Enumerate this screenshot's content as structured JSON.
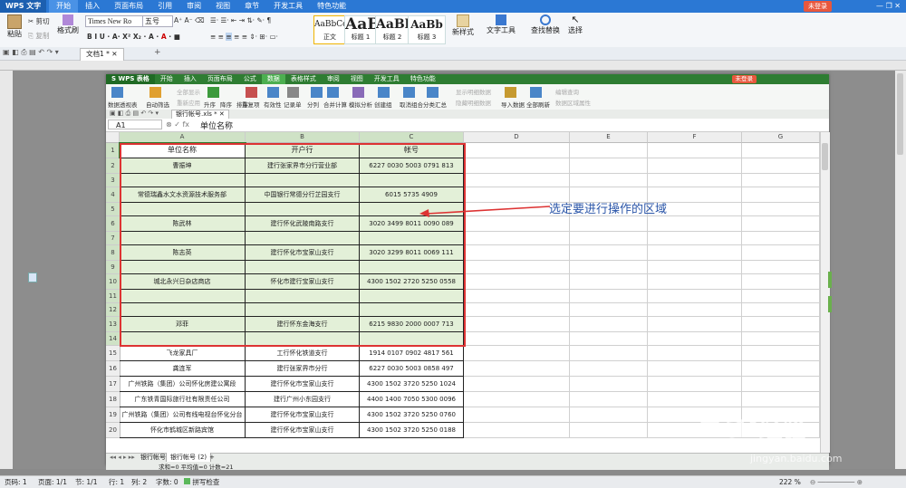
{
  "writer": {
    "app_name": "WPS 文字",
    "menus": [
      "开始",
      "插入",
      "页面布局",
      "引用",
      "审阅",
      "视图",
      "章节",
      "开发工具",
      "特色功能"
    ],
    "login": "未登录",
    "ribbon": {
      "paste": "粘贴",
      "cut": "剪切",
      "copy": "复制",
      "format_painter": "格式刷",
      "font_name": "Times New Ro",
      "font_size": "五号",
      "styles": [
        {
          "preview": "AaBbCc",
          "label": "正文"
        },
        {
          "preview": "AaB",
          "label": "标题 1"
        },
        {
          "preview": "AaBl",
          "label": "标题 2"
        },
        {
          "preview": "AaBb",
          "label": "标题 3"
        }
      ],
      "new_style": "新样式",
      "text_tools": "文字工具",
      "find_replace": "查找替换",
      "select": "选择"
    },
    "doc_tab": "文档1 *",
    "status": {
      "page": "页码: 1",
      "pages": "页面: 1/1",
      "section": "节: 1/1",
      "row": "行: 1",
      "col": "列: 2",
      "words": "字数: 0",
      "spellcheck": "拼写检查",
      "zoom": "222 %"
    }
  },
  "et": {
    "app_name": "S WPS 表格",
    "menus": [
      "开始",
      "插入",
      "页面布局",
      "公式",
      "数据",
      "表格样式",
      "审阅",
      "视图",
      "开发工具",
      "特色功能"
    ],
    "login": "未登录",
    "ribbon": [
      "数据透视表",
      "自动筛选",
      "全部显示",
      "重新应用",
      "升序",
      "降序",
      "排序",
      "重复项",
      "有效性",
      "记录单",
      "分列",
      "合并计算",
      "模拟分析",
      "创建组",
      "取消组合",
      "分类汇总",
      "显示明细数据",
      "隐藏明细数据",
      "导入数据",
      "全部刷新",
      "编辑查询",
      "数据区域属性"
    ],
    "file_tab": "银行帐号.xls *",
    "name_box": "A1",
    "formula_value": "单位名称",
    "columns": [
      "A",
      "B",
      "C",
      "D",
      "E",
      "F",
      "G"
    ],
    "rows": [
      {
        "n": "1",
        "a": "单位名称",
        "b": "开户行",
        "c": "帐号"
      },
      {
        "n": "2",
        "a": "曹振坤",
        "b": "建行张家界市分行营业部",
        "c": "6227 0030 5003 0791 813"
      },
      {
        "n": "3",
        "a": "",
        "b": "",
        "c": ""
      },
      {
        "n": "4",
        "a": "常德瑞鑫水文水资源技术服务部",
        "b": "中国银行常德分行芷园支行",
        "c": "6015 5735 4909"
      },
      {
        "n": "5",
        "a": "",
        "b": "",
        "c": ""
      },
      {
        "n": "6",
        "a": "陈武林",
        "b": "建行怀化武陵南路支行",
        "c": "3020 3499 8011 0090 089"
      },
      {
        "n": "7",
        "a": "",
        "b": "",
        "c": ""
      },
      {
        "n": "8",
        "a": "陈志英",
        "b": "建行怀化市宝家山支行",
        "c": "3020 3299 8011 0069 111"
      },
      {
        "n": "9",
        "a": "",
        "b": "",
        "c": ""
      },
      {
        "n": "10",
        "a": "城北永兴日杂店商店",
        "b": "怀化市建行宝家山支行",
        "c": "4300 1502 2720 5250 0558"
      },
      {
        "n": "11",
        "a": "",
        "b": "",
        "c": ""
      },
      {
        "n": "12",
        "a": "",
        "b": "",
        "c": ""
      },
      {
        "n": "13",
        "a": "邓菲",
        "b": "建行怀东金海支行",
        "c": "6215 9830 2000 0007 713"
      },
      {
        "n": "14",
        "a": "",
        "b": "",
        "c": ""
      },
      {
        "n": "15",
        "a": "飞龙家具厂",
        "b": "工行怀化铁道支行",
        "c": "1914 0107 0902 4817 561"
      },
      {
        "n": "16",
        "a": "龚连军",
        "b": "建行张家界市分行",
        "c": "6227 0030 5003 0858 497"
      },
      {
        "n": "17",
        "a": "广州铁路（集团）公司怀化房建公寓段",
        "b": "建行怀化市宝家山支行",
        "c": "4300 1502 3720 5250 1024"
      },
      {
        "n": "18",
        "a": "广东铁青国际旅行社有限责任公司",
        "b": "建行广州小东园支行",
        "c": "4400 1400 7050 5300 0096"
      },
      {
        "n": "19",
        "a": "广州铁路（集团）公司有线电视台怀化分台",
        "b": "建行怀化市宝家山支行",
        "c": "4300 1502 3720 5250 0760"
      },
      {
        "n": "20",
        "a": "怀化市鹤城区新路宾馆",
        "b": "建行怀化市宝家山支行",
        "c": "4300 1502 3720 5250 0188"
      }
    ],
    "sheets": [
      "银行帐号",
      "银行帐号 (2)"
    ],
    "status_sum": "求和=0  平均值=0  计数=21"
  },
  "annotation": "选定要进行操作的区域",
  "watermark": {
    "brand": "Bai",
    "brand2": "经验",
    "url": "jingyan.baidu.com"
  },
  "colors": {
    "writer_blue": "#2b78d4",
    "et_green": "#2e7d32",
    "selection_fill": "#e3f0d8",
    "highlight_red": "#dd3333",
    "annotation_blue": "#2a55a8"
  }
}
